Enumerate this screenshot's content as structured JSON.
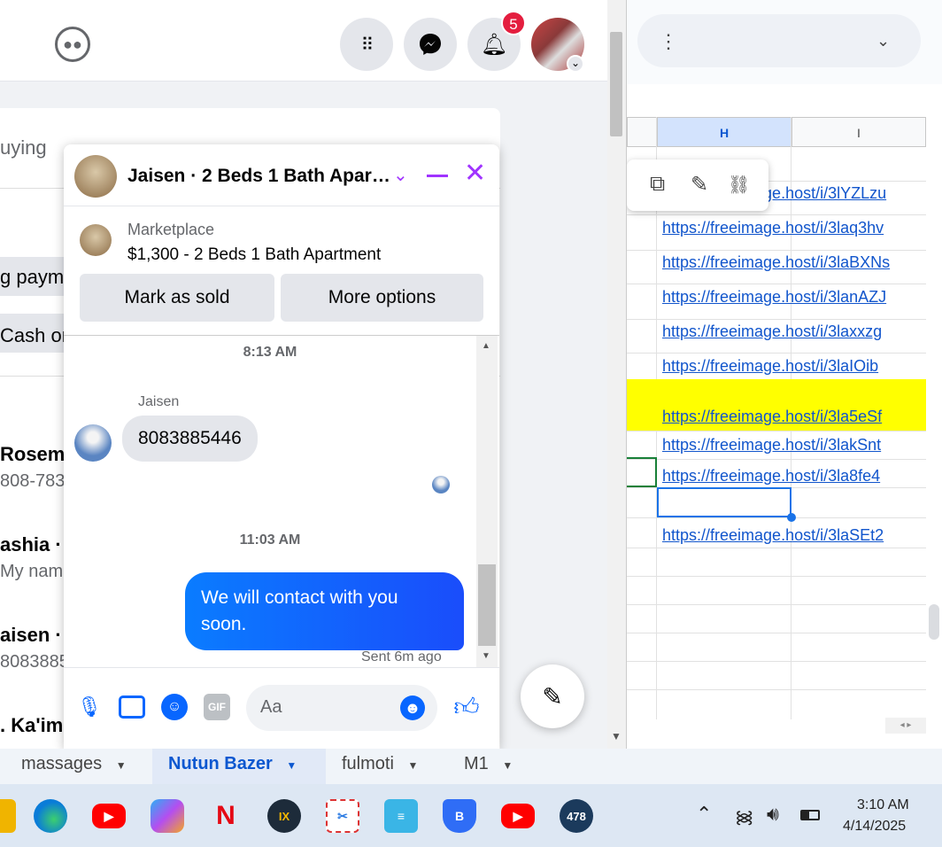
{
  "sheet": {
    "col_h": "H",
    "col_i": "I",
    "links": [
      "https://freeimage.host/i/3lYZLzu",
      "https://freeimage.host/i/3laq3hv",
      "https://freeimage.host/i/3laBXNs",
      "https://freeimage.host/i/3lanAZJ",
      "https://freeimage.host/i/3laxxzg",
      "https://freeimage.host/i/3laIOib",
      "https://freeimage.host/i/3la5eSf",
      "https://freeimage.host/i/3lakSnt",
      "https://freeimage.host/i/3la8fe4",
      "https://freeimage.host/i/3laSEt2"
    ],
    "highlight_color": "#ffff00",
    "tabs": [
      "massages",
      "Nutun Bazer",
      "fulmoti",
      "M1"
    ]
  },
  "facebook": {
    "notif_count": "5",
    "list_fragments": {
      "buying": "uying",
      "payment": "g paym",
      "cash": "Cash on",
      "p1_name": "Rosema",
      "p1_sub": "808-783-",
      "p2_name": "ashia ·",
      "p2_sub": "My name",
      "p3_name": "aisen ·",
      "p3_sub": "8083885",
      "p4_name": ". Ka'im"
    }
  },
  "chat": {
    "title": "Jaisen · 2 Beds 1 Bath Apar…",
    "marketplace_label": "Marketplace",
    "listing": "$1,300 - 2 Beds 1 Bath Apartment",
    "mark_sold": "Mark as sold",
    "more_options": "More options",
    "time1": "8:13 AM",
    "sender": "Jaisen",
    "msg_in": "8083885446",
    "time2": "11:03 AM",
    "msg_out": "We will contact with you soon.",
    "sent_status": "Sent 6m ago",
    "input_placeholder": "Aa",
    "accent": "#0866ff"
  },
  "taskbar": {
    "time": "3:10 AM",
    "date": "4/14/2025",
    "badge": "478"
  }
}
